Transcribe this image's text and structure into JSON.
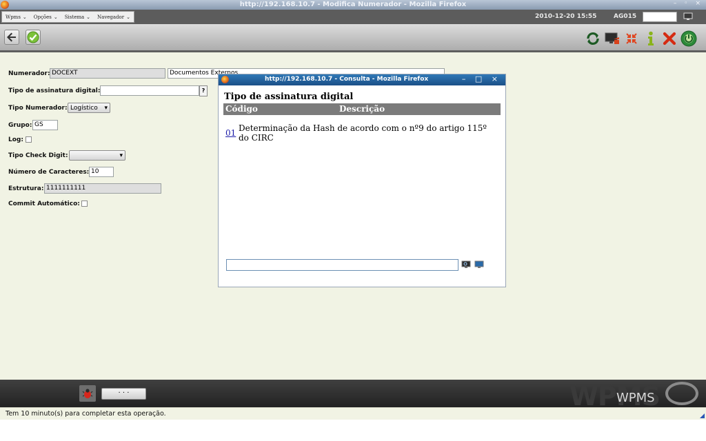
{
  "window": {
    "title": "http://192.168.10.7 - Modifica Numerador - Mozilla Firefox"
  },
  "menubar": {
    "menus": [
      "Wpms",
      "Opções",
      "Sistema",
      "Navegador"
    ],
    "datetime": "2010-12-20 15:55",
    "user": "AG015",
    "user_input": ""
  },
  "toolbar": {
    "left_icons": [
      "back-arrow-icon",
      "check-icon"
    ],
    "right_icons": [
      "refresh-icon",
      "monitor-export-icon",
      "shrink-icon",
      "info-icon",
      "close-x-icon",
      "globe-power-icon"
    ]
  },
  "form": {
    "numerador_label": "Numerador:",
    "numerador_value": "DOCEXT",
    "numerador_desc": "Documentos Externos",
    "tipo_assinatura_label": "Tipo de assinatura digital:",
    "tipo_assinatura_value": "",
    "lookup_button": "?",
    "tipo_numerador_label": "Tipo Numerador:",
    "tipo_numerador_value": "Logístico",
    "grupo_label": "Grupo:",
    "grupo_value": "GS",
    "log_label": "Log:",
    "tipo_check_digit_label": "Tipo Check Digit:",
    "tipo_check_digit_value": "",
    "numero_caracteres_label": "Número de Caracteres:",
    "numero_caracteres_value": "10",
    "estrutura_label": "Estrutura:",
    "estrutura_value": "1111111111",
    "commit_label": "Commit Automático:"
  },
  "popup": {
    "title": "http://192.168.10.7 - Consulta - Mozilla Firefox",
    "heading": "Tipo de assinatura digital",
    "columns": [
      "Código",
      "Descrição"
    ],
    "rows": [
      {
        "code": "01",
        "description": "Determinação da Hash de acordo com o nº9 do artigo 115º do CIRC"
      }
    ],
    "search_value": ""
  },
  "bottombar": {
    "dots_label": "· · ·",
    "watermark_big": "WPMS",
    "watermark_small": "WPMS"
  },
  "status": {
    "text": "Tem 10 minuto(s) para completar esta operação."
  },
  "colors": {
    "toolbar_dark": "#5c5c5c",
    "popup_title": "#1b4f87",
    "table_header": "#7b7b7b",
    "background": "#f1f3e4"
  }
}
